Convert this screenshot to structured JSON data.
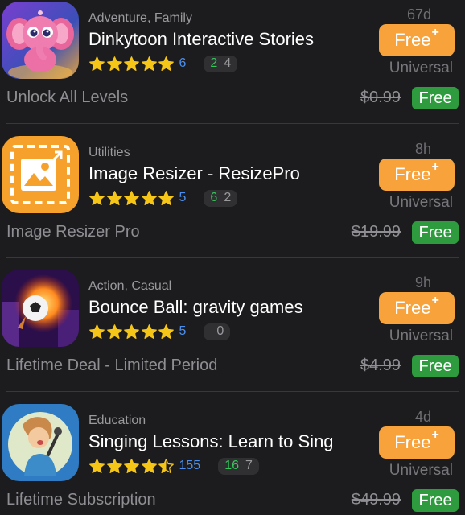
{
  "apps": [
    {
      "category": "Adventure, Family",
      "title": "Dinkytoon Interactive Stories",
      "stars": 5,
      "rating_count": "6",
      "pill_green": "2",
      "pill_gray": "4",
      "age": "67d",
      "free_label": "Free",
      "plus": "+",
      "platform": "Universal",
      "iap_name": "Unlock All Levels",
      "old_price": "$0.99",
      "free_badge": "Free",
      "icon": "elephant-icon"
    },
    {
      "category": "Utilities",
      "title": "Image Resizer - ResizePro",
      "stars": 5,
      "rating_count": "5",
      "pill_green": "6",
      "pill_gray": "2",
      "age": "8h",
      "free_label": "Free",
      "plus": "+",
      "platform": "Universal",
      "iap_name": "Image Resizer Pro",
      "old_price": "$19.99",
      "free_badge": "Free",
      "icon": "image-resize-icon"
    },
    {
      "category": "Action, Casual",
      "title": "Bounce Ball: gravity games",
      "stars": 5,
      "rating_count": "5",
      "pill_green": "",
      "pill_gray": "0",
      "age": "9h",
      "free_label": "Free",
      "plus": "+",
      "platform": "Universal",
      "iap_name": "Lifetime Deal - Limited Period",
      "old_price": "$4.99",
      "free_badge": "Free",
      "icon": "fire-ball-icon"
    },
    {
      "category": "Education",
      "title": "Singing Lessons: Learn to Sing",
      "stars": 4.5,
      "rating_count": "155",
      "pill_green": "16",
      "pill_gray": "7",
      "age": "4d",
      "free_label": "Free",
      "plus": "+",
      "platform": "Universal",
      "iap_name": "Lifetime Subscription",
      "old_price": "$49.99",
      "free_badge": "Free",
      "icon": "singer-icon"
    }
  ],
  "colors": {
    "background": "#1c1c1e",
    "accent_orange": "#f7a23b",
    "free_green": "#2e9b3e",
    "star_yellow": "#f5c518",
    "link_blue": "#4a8ff0"
  }
}
